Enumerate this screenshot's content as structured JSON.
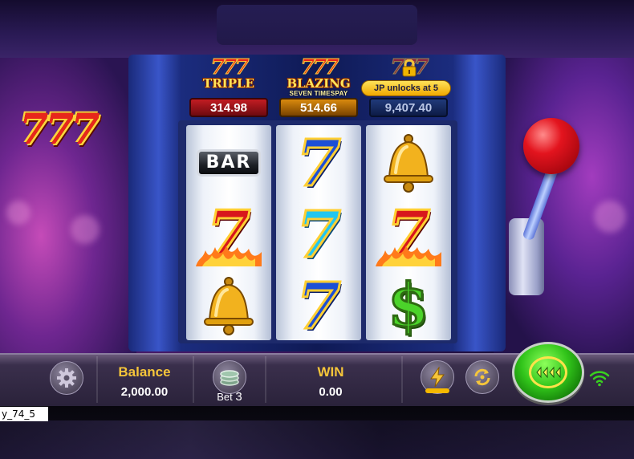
{
  "game": {
    "logo_text": "777"
  },
  "jackpots": [
    {
      "sevens": "777",
      "name": "TRIPLE",
      "subtitle": "",
      "value": "314.98",
      "color": "#c21c22"
    },
    {
      "sevens": "777",
      "name": "BLAZING",
      "subtitle": "SEVEN TIMESPAY",
      "value": "514.66",
      "color": "#d98a0e"
    },
    {
      "sevens": "777",
      "name": "",
      "subtitle": "",
      "value": "9,407.40",
      "color": "#203a7a",
      "unlock_text": "JP unlocks at 5",
      "locked": true
    }
  ],
  "reels": [
    [
      "bar",
      "fire-seven",
      "bell"
    ],
    [
      "blue-seven",
      "cyan-seven",
      "blue-seven"
    ],
    [
      "bell",
      "fire-seven",
      "dollar"
    ]
  ],
  "symbols": {
    "bar_text": "BAR",
    "seven_text": "7",
    "dollar_text": "$"
  },
  "bottom_bar": {
    "balance_label": "Balance",
    "balance_value": "2,000.00",
    "bet_label": "Bet",
    "bet_value": "3",
    "win_label": "WIN",
    "win_value": "0.00"
  },
  "footer": {
    "code": "y_74_5"
  },
  "icons": {
    "settings": "gear-icon",
    "bet": "coin-stack-icon",
    "turbo": "lightning-icon",
    "auto": "auto-spin-icon",
    "spin": "spin-icon",
    "signal": "wifi-icon"
  },
  "colors": {
    "accent_gold": "#f5c53a",
    "spin_green": "#31c41a",
    "reel_blue": "#1d2a6b"
  }
}
